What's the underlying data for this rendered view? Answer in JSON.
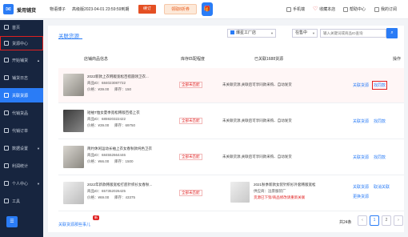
{
  "app": {
    "logo_glyph": "✉",
    "name": "爱用铺货"
  },
  "topbar": {
    "shop": "物语博子",
    "expiry": "高级版2023-04-01 23:59:59到期",
    "renew_label": "续订",
    "promo_label": "领取8折券",
    "nav": [
      {
        "label": "手机端",
        "icon": "phone-icon"
      },
      {
        "label": "收藏本店",
        "icon": "heart-icon"
      },
      {
        "label": "帮助中心",
        "icon": "help-icon"
      },
      {
        "label": "我的订阅",
        "icon": "user-icon"
      }
    ]
  },
  "sidebar": {
    "items": [
      {
        "label": "首页",
        "icon": "home-icon"
      },
      {
        "label": "货源中心",
        "icon": "source-icon",
        "boxed": true
      },
      {
        "label": "开始铺货",
        "icon": "upload-icon",
        "caret": "▲"
      },
      {
        "label": "铺货日志",
        "icon": "log-icon"
      },
      {
        "label": "关联货源",
        "icon": "link-icon",
        "active": true
      },
      {
        "label": "代销货品",
        "icon": "goods-icon"
      },
      {
        "label": "代销订单",
        "icon": "order-icon"
      },
      {
        "label": "数据设置",
        "icon": "settings-icon",
        "caret": "▼"
      },
      {
        "label": "利润统计",
        "icon": "stats-icon"
      },
      {
        "label": "个人中心",
        "icon": "person-icon",
        "caret": "▼"
      },
      {
        "label": "工具",
        "icon": "tools-icon"
      }
    ],
    "bottom_glyph": "☰"
  },
  "main": {
    "tab_title": "关联货源",
    "filter_shop": "爆星工厂店",
    "filter_status": "在售中",
    "search_placeholder": "输入关键词或商品ID查询",
    "search_icon": "search-icon",
    "columns": [
      "店铺商品信息",
      "库存匹配程度",
      "已关联1688货源",
      "操作"
    ],
    "rows": [
      {
        "name": "2022新款上衣韩版宽松百搭圆领卫衣...",
        "id": "商品ID：684023087722",
        "price": "价格：¥39.00",
        "stock": "库存：150",
        "match": "全部未匹配",
        "linked_text": "未关联货源,关联后可享同款采购、自动发货",
        "actions": [
          "关联货源",
          "找同款"
        ],
        "highlight": true,
        "boxed_action": 1
      },
      {
        "name": "短袖T恤女夏季宽松韩版百搭上衣",
        "id": "商品ID：685920322422",
        "price": "价格：¥39.00",
        "stock": "库存：69750",
        "match": "全部未匹配",
        "linked_text": "未关联货源,关联后可享同款采购、自动发货",
        "actions": [
          "关联货源",
          "找同款"
        ],
        "highlight": false
      },
      {
        "name": "简约休闲运动长袖上衣女春秋款纯色卫衣",
        "id": "商品ID：684552664446",
        "price": "价格：¥66.00",
        "stock": "库存：1500",
        "match": "全部未匹配",
        "linked_text": "未关联货源,关联后可享同款采购、自动发货",
        "actions": [
          "关联货源",
          "找同款"
        ],
        "highlight": false
      },
      {
        "name": "2022年新款韩版宽松打底针织衫女春秋...",
        "id": "商品ID：657352026425",
        "price": "价格：¥69.00",
        "stock": "库存：43375",
        "match": "全部未匹配",
        "linked_name": "2021秋季新款女装针织衫外套韩版宽松",
        "linked_src": "供应商：远景服装厂",
        "linked_warn": "货源已下架/商品修改请重新关联",
        "actions": [
          "关联货源",
          "取消关联",
          "更换货源"
        ],
        "highlight": false
      }
    ]
  },
  "footer": {
    "link": "关联货源那些事儿",
    "badge": "新",
    "total": "共24条",
    "pages": [
      "1",
      "2"
    ],
    "prev": "‹",
    "next": "›"
  },
  "colors": {
    "accent": "#2a7cf6",
    "sidebar_bg": "#17253f",
    "warn": "#e02020"
  }
}
